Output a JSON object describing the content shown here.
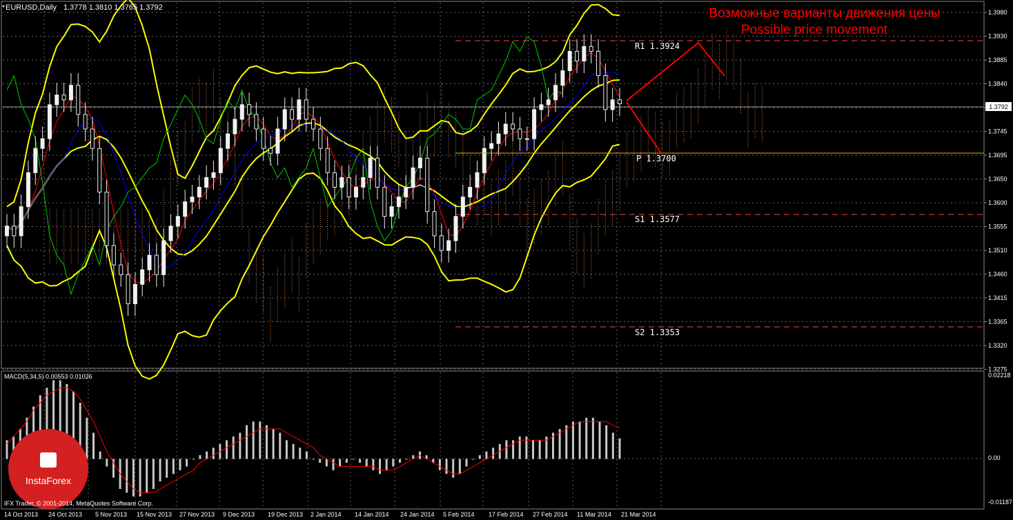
{
  "header": {
    "symbol": "EURUSD,Daily",
    "ohlc": "1.3778 1.3810 1.3765 1.3792"
  },
  "annotation": {
    "line1": "Возможные варианты движения цены",
    "line2": "Possible price movement",
    "color": "#ff0000"
  },
  "levels": {
    "r1_label": "R1  1.3924",
    "p_label": "P  1.3700",
    "s1_label": "S1  1.3577",
    "s2_label": "S2  1.3353",
    "current_price": "1.3792"
  },
  "price_axis": {
    "ticks": [
      "1.3980",
      "1.3930",
      "1.3885",
      "1.3840",
      "1.3792",
      "1.3745",
      "1.3695",
      "1.3650",
      "1.3600",
      "1.3555",
      "1.3510",
      "1.3460",
      "1.3415",
      "1.3365",
      "1.3320",
      "1.3275"
    ]
  },
  "macd": {
    "title": "MACD(5,34,5) 0.00553 0.01026",
    "axis_ticks": [
      "0.02218",
      "0.00",
      "-0.01187"
    ]
  },
  "date_axis": {
    "labels": [
      "14 Oct 2013",
      "24 Oct 2013",
      "5 Nov 2013",
      "15 Nov 2013",
      "27 Nov 2013",
      "9 Dec 2013",
      "19 Dec 2013",
      "2 Jan 2014",
      "14 Jan 2014",
      "24 Jan 2014",
      "5 Feb 2014",
      "17 Feb 2014",
      "27 Feb 2014",
      "11 Mar 2014",
      "21 Mar 2014"
    ]
  },
  "watermark": {
    "brand": "InstaForex",
    "copyright": "IFX Trader, © 2001-2014, MetaQuotes Software Corp."
  },
  "colors": {
    "background": "#000000",
    "grid": "#6a6a6a",
    "candle_body": "#f0f0f0",
    "bollinger": "#ffff00",
    "ichimoku_tenkan": "#ff0000",
    "ichimoku_kijun": "#0000ff",
    "chikou": "#00cc00",
    "cloud": "#ffb070",
    "macd_hist": "#c8c8c8",
    "macd_signal": "#ff0000",
    "level_line": "#ff4040",
    "pivot_line": "#ffaa00"
  },
  "chart_data": [
    {
      "type": "candlestick",
      "symbol": "EURUSD",
      "timeframe": "Daily",
      "last_ohlc": {
        "open": 1.3778,
        "high": 1.381,
        "low": 1.3765,
        "close": 1.3792
      },
      "ylim": [
        1.325,
        1.4
      ],
      "x_tick_labels": [
        "14 Oct 2013",
        "24 Oct 2013",
        "5 Nov 2013",
        "15 Nov 2013",
        "27 Nov 2013",
        "9 Dec 2013",
        "19 Dec 2013",
        "2 Jan 2014",
        "14 Jan 2014",
        "24 Jan 2014",
        "5 Feb 2014",
        "17 Feb 2014",
        "27 Feb 2014",
        "11 Mar 2014",
        "21 Mar 2014"
      ],
      "y_tick_labels": [
        "1.3980",
        "1.3930",
        "1.3885",
        "1.3840",
        "1.3792",
        "1.3745",
        "1.3695",
        "1.3650",
        "1.3600",
        "1.3555",
        "1.3510",
        "1.3460",
        "1.3415",
        "1.3365",
        "1.3320",
        "1.3275"
      ],
      "closes": [
        1.354,
        1.352,
        1.358,
        1.365,
        1.37,
        1.372,
        1.379,
        1.381,
        1.38,
        1.383,
        1.377,
        1.374,
        1.37,
        1.361,
        1.35,
        1.346,
        1.344,
        1.338,
        1.342,
        1.345,
        1.348,
        1.344,
        1.351,
        1.354,
        1.356,
        1.359,
        1.36,
        1.362,
        1.364,
        1.365,
        1.37,
        1.373,
        1.376,
        1.379,
        1.377,
        1.374,
        1.37,
        1.369,
        1.374,
        1.378,
        1.376,
        1.38,
        1.376,
        1.374,
        1.37,
        1.365,
        1.362,
        1.364,
        1.36,
        1.362,
        1.364,
        1.368,
        1.362,
        1.356,
        1.358,
        1.36,
        1.362,
        1.366,
        1.368,
        1.357,
        1.352,
        1.349,
        1.351,
        1.356,
        1.36,
        1.362,
        1.365,
        1.37,
        1.371,
        1.373,
        1.375,
        1.374,
        1.372,
        1.372,
        1.378,
        1.379,
        1.38,
        1.383,
        1.386,
        1.39,
        1.388,
        1.391,
        1.39,
        1.385,
        1.378,
        1.38,
        1.3792
      ],
      "levels": [
        {
          "name": "R1",
          "value": 1.3924
        },
        {
          "name": "P",
          "value": 1.37
        },
        {
          "name": "S1",
          "value": 1.3577
        },
        {
          "name": "S2",
          "value": 1.3353
        }
      ],
      "indicators": [
        "Bollinger Bands",
        "Ichimoku",
        "Chikou span"
      ]
    },
    {
      "type": "bar",
      "title": "MACD(5,34,5) 0.00553 0.01026",
      "macd_value": 0.00553,
      "signal_value": 0.01026,
      "ylim": [
        -0.01187,
        0.02218
      ],
      "y_tick_labels": [
        "0.02218",
        "0.00",
        "-0.01187"
      ],
      "histogram": [
        0.005,
        0.006,
        0.008,
        0.011,
        0.014,
        0.017,
        0.019,
        0.021,
        0.021,
        0.02,
        0.018,
        0.015,
        0.011,
        0.007,
        0.002,
        -0.002,
        -0.005,
        -0.008,
        -0.009,
        -0.01,
        -0.01,
        -0.009,
        -0.008,
        -0.006,
        -0.005,
        -0.004,
        -0.003,
        -0.002,
        0.0,
        0.001,
        0.002,
        0.003,
        0.004,
        0.005,
        0.006,
        0.007,
        0.009,
        0.01,
        0.01,
        0.009,
        0.008,
        0.007,
        0.005,
        0.004,
        0.003,
        0.002,
        0.0,
        -0.001,
        -0.002,
        -0.003,
        -0.002,
        -0.001,
        0.0,
        -0.001,
        -0.002,
        -0.003,
        -0.004,
        -0.003,
        -0.002,
        -0.001,
        0.0,
        0.001,
        0.002,
        0.001,
        -0.001,
        -0.003,
        -0.004,
        -0.005,
        -0.004,
        -0.002,
        0.0,
        0.001,
        0.002,
        0.003,
        0.004,
        0.005,
        0.005,
        0.006,
        0.006,
        0.005,
        0.005,
        0.006,
        0.007,
        0.008,
        0.009,
        0.01,
        0.01,
        0.011,
        0.011,
        0.01,
        0.009,
        0.007,
        0.0055
      ],
      "signal": [
        0.004,
        0.006,
        0.008,
        0.01,
        0.013,
        0.015,
        0.017,
        0.018,
        0.019,
        0.019,
        0.018,
        0.016,
        0.013,
        0.01,
        0.006,
        0.002,
        -0.001,
        -0.004,
        -0.006,
        -0.008,
        -0.009,
        -0.009,
        -0.009,
        -0.008,
        -0.007,
        -0.006,
        -0.005,
        -0.004,
        -0.003,
        -0.001,
        0.0,
        0.001,
        0.002,
        0.003,
        0.004,
        0.005,
        0.006,
        0.007,
        0.008,
        0.008,
        0.008,
        0.008,
        0.007,
        0.006,
        0.005,
        0.004,
        0.003,
        0.001,
        0.0,
        -0.001,
        -0.002,
        -0.002,
        -0.002,
        -0.002,
        -0.002,
        -0.002,
        -0.003,
        -0.003,
        -0.003,
        -0.002,
        -0.001,
        0.0,
        0.001,
        0.0,
        -0.001,
        -0.002,
        -0.003,
        -0.004,
        -0.004,
        -0.003,
        -0.002,
        -0.001,
        0.0,
        0.001,
        0.002,
        0.003,
        0.004,
        0.005,
        0.005,
        0.005,
        0.005,
        0.005,
        0.006,
        0.007,
        0.008,
        0.009,
        0.01,
        0.01,
        0.01,
        0.01,
        0.01,
        0.009,
        0.00826
      ]
    }
  ]
}
